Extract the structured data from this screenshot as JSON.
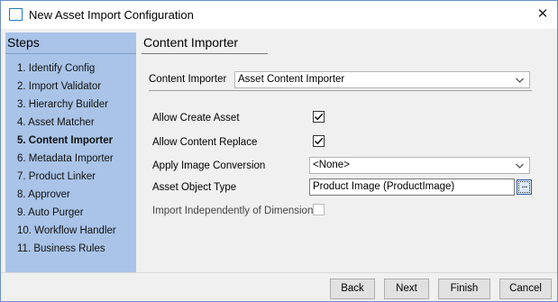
{
  "window": {
    "title": "New Asset Import Configuration"
  },
  "steps": {
    "header": "Steps",
    "items": [
      {
        "label": "1. Identify Config",
        "active": false
      },
      {
        "label": "2. Import Validator",
        "active": false
      },
      {
        "label": "3. Hierarchy Builder",
        "active": false
      },
      {
        "label": "4. Asset Matcher",
        "active": false
      },
      {
        "label": "5. Content Importer",
        "active": true
      },
      {
        "label": "6. Metadata Importer",
        "active": false
      },
      {
        "label": "7. Product Linker",
        "active": false
      },
      {
        "label": "8. Approver",
        "active": false
      },
      {
        "label": "9. Auto Purger",
        "active": false
      },
      {
        "label": "10. Workflow Handler",
        "active": false
      },
      {
        "label": "11. Business Rules",
        "active": false
      }
    ]
  },
  "main": {
    "section_title": "Content Importer",
    "content_importer": {
      "label": "Content Importer",
      "value": "Asset Content Importer"
    },
    "allow_create_asset": {
      "label": "Allow Create Asset",
      "checked": true
    },
    "allow_content_replace": {
      "label": "Allow Content Replace",
      "checked": true
    },
    "apply_image_conversion": {
      "label": "Apply Image Conversion",
      "value": "<None>"
    },
    "asset_object_type": {
      "label": "Asset Object Type",
      "value": "Product Image (ProductImage)",
      "browse_label": "..."
    },
    "import_independently": {
      "label": "Import Independently of Dimension",
      "checked": false,
      "enabled": false
    }
  },
  "buttons": {
    "back": "Back",
    "next": "Next",
    "finish": "Finish",
    "cancel": "Cancel"
  },
  "icons": {
    "title": "window-icon",
    "close": "close-icon",
    "dropdown": "chevron-down-icon",
    "check": "checkmark-icon"
  }
}
